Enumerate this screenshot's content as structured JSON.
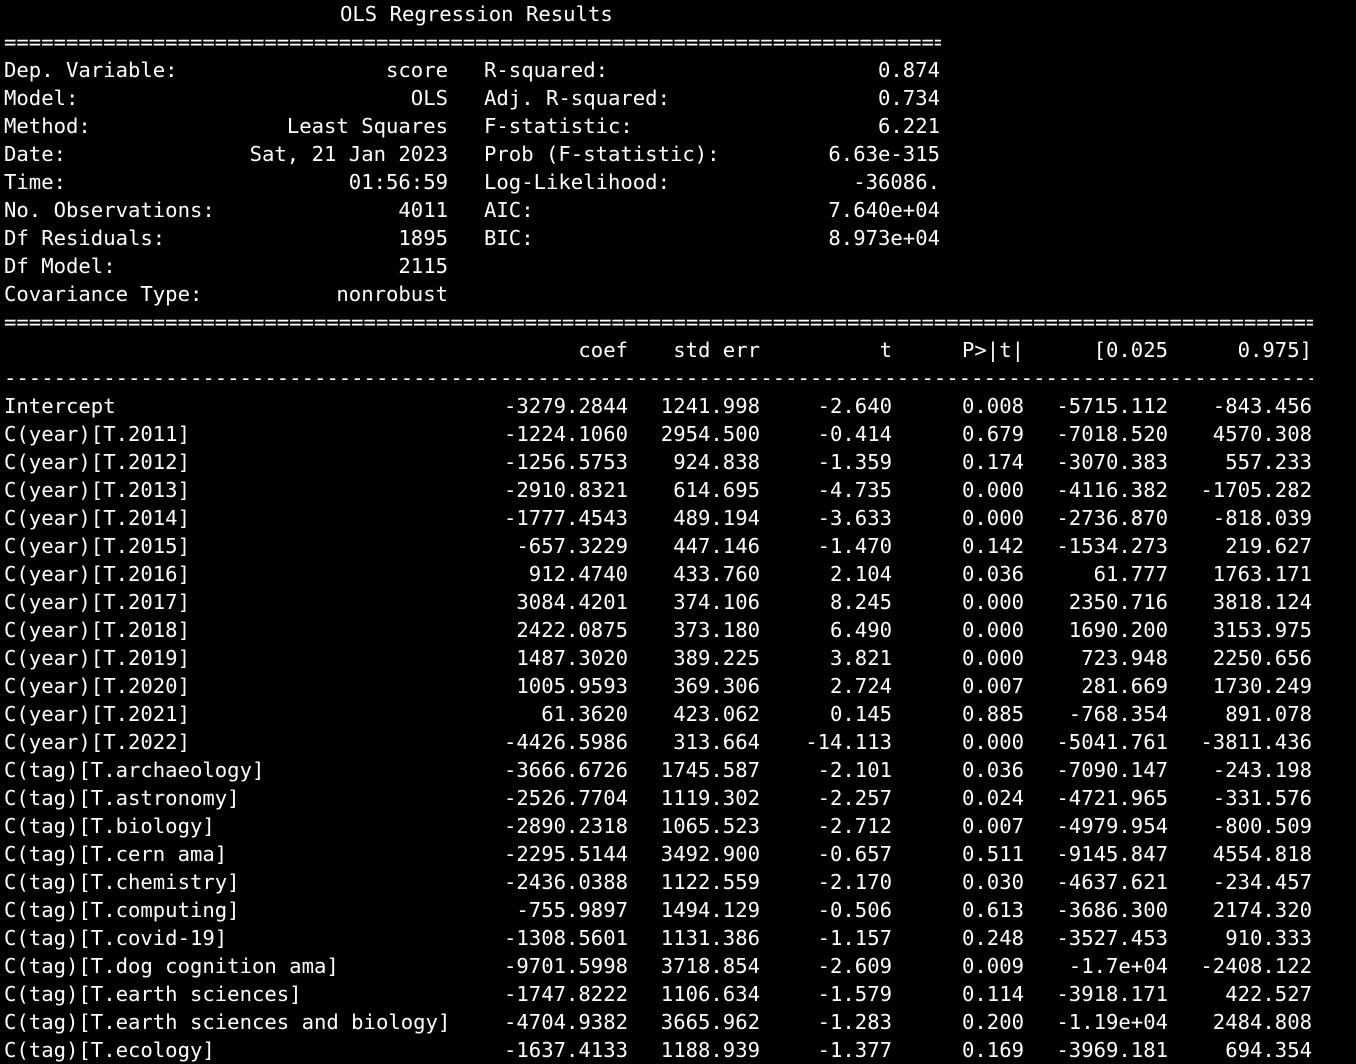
{
  "title": "OLS Regression Results",
  "rules": {
    "double_short": "==============================================================================",
    "double_long": "==============================================================================================================",
    "single_long": "--------------------------------------------------------------------------------------------------------------"
  },
  "summary": [
    {
      "l_label": "Dep. Variable:",
      "l_value": "score",
      "r_label": "R-squared:",
      "r_value": "0.874"
    },
    {
      "l_label": "Model:",
      "l_value": "OLS",
      "r_label": "Adj. R-squared:",
      "r_value": "0.734"
    },
    {
      "l_label": "Method:",
      "l_value": "Least Squares",
      "r_label": "F-statistic:",
      "r_value": "6.221"
    },
    {
      "l_label": "Date:",
      "l_value": "Sat, 21 Jan 2023",
      "r_label": "Prob (F-statistic):",
      "r_value": "6.63e-315"
    },
    {
      "l_label": "Time:",
      "l_value": "01:56:59",
      "r_label": "Log-Likelihood:",
      "r_value": "-36086."
    },
    {
      "l_label": "No. Observations:",
      "l_value": "4011",
      "r_label": "AIC:",
      "r_value": "7.640e+04"
    },
    {
      "l_label": "Df Residuals:",
      "l_value": "1895",
      "r_label": "BIC:",
      "r_value": "8.973e+04"
    },
    {
      "l_label": "Df Model:",
      "l_value": "2115",
      "r_label": "",
      "r_value": ""
    },
    {
      "l_label": "Covariance Type:",
      "l_value": "nonrobust",
      "r_label": "",
      "r_value": ""
    }
  ],
  "headers": [
    "coef",
    "std err",
    "t",
    "P>|t|",
    "[0.025",
    "0.975]"
  ],
  "rows": [
    [
      "Intercept",
      "-3279.2844",
      "1241.998",
      "-2.640",
      "0.008",
      "-5715.112",
      "-843.456"
    ],
    [
      "C(year)[T.2011]",
      "-1224.1060",
      "2954.500",
      "-0.414",
      "0.679",
      "-7018.520",
      "4570.308"
    ],
    [
      "C(year)[T.2012]",
      "-1256.5753",
      "924.838",
      "-1.359",
      "0.174",
      "-3070.383",
      "557.233"
    ],
    [
      "C(year)[T.2013]",
      "-2910.8321",
      "614.695",
      "-4.735",
      "0.000",
      "-4116.382",
      "-1705.282"
    ],
    [
      "C(year)[T.2014]",
      "-1777.4543",
      "489.194",
      "-3.633",
      "0.000",
      "-2736.870",
      "-818.039"
    ],
    [
      "C(year)[T.2015]",
      "-657.3229",
      "447.146",
      "-1.470",
      "0.142",
      "-1534.273",
      "219.627"
    ],
    [
      "C(year)[T.2016]",
      "912.4740",
      "433.760",
      "2.104",
      "0.036",
      "61.777",
      "1763.171"
    ],
    [
      "C(year)[T.2017]",
      "3084.4201",
      "374.106",
      "8.245",
      "0.000",
      "2350.716",
      "3818.124"
    ],
    [
      "C(year)[T.2018]",
      "2422.0875",
      "373.180",
      "6.490",
      "0.000",
      "1690.200",
      "3153.975"
    ],
    [
      "C(year)[T.2019]",
      "1487.3020",
      "389.225",
      "3.821",
      "0.000",
      "723.948",
      "2250.656"
    ],
    [
      "C(year)[T.2020]",
      "1005.9593",
      "369.306",
      "2.724",
      "0.007",
      "281.669",
      "1730.249"
    ],
    [
      "C(year)[T.2021]",
      "61.3620",
      "423.062",
      "0.145",
      "0.885",
      "-768.354",
      "891.078"
    ],
    [
      "C(year)[T.2022]",
      "-4426.5986",
      "313.664",
      "-14.113",
      "0.000",
      "-5041.761",
      "-3811.436"
    ],
    [
      "C(tag)[T.archaeology]",
      "-3666.6726",
      "1745.587",
      "-2.101",
      "0.036",
      "-7090.147",
      "-243.198"
    ],
    [
      "C(tag)[T.astronomy]",
      "-2526.7704",
      "1119.302",
      "-2.257",
      "0.024",
      "-4721.965",
      "-331.576"
    ],
    [
      "C(tag)[T.biology]",
      "-2890.2318",
      "1065.523",
      "-2.712",
      "0.007",
      "-4979.954",
      "-800.509"
    ],
    [
      "C(tag)[T.cern ama]",
      "-2295.5144",
      "3492.900",
      "-0.657",
      "0.511",
      "-9145.847",
      "4554.818"
    ],
    [
      "C(tag)[T.chemistry]",
      "-2436.0388",
      "1122.559",
      "-2.170",
      "0.030",
      "-4637.621",
      "-234.457"
    ],
    [
      "C(tag)[T.computing]",
      "-755.9897",
      "1494.129",
      "-0.506",
      "0.613",
      "-3686.300",
      "2174.320"
    ],
    [
      "C(tag)[T.covid-19]",
      "-1308.5601",
      "1131.386",
      "-1.157",
      "0.248",
      "-3527.453",
      "910.333"
    ],
    [
      "C(tag)[T.dog cognition ama]",
      "-9701.5998",
      "3718.854",
      "-2.609",
      "0.009",
      "-1.7e+04",
      "-2408.122"
    ],
    [
      "C(tag)[T.earth sciences]",
      "-1747.8222",
      "1106.634",
      "-1.579",
      "0.114",
      "-3918.171",
      "422.527"
    ],
    [
      "C(tag)[T.earth sciences and biology]",
      "-4704.9382",
      "3665.962",
      "-1.283",
      "0.200",
      "-1.19e+04",
      "2484.808"
    ],
    [
      "C(tag)[T.ecology]",
      "-1637.4133",
      "1188.939",
      "-1.377",
      "0.169",
      "-3969.181",
      "694.354"
    ]
  ]
}
